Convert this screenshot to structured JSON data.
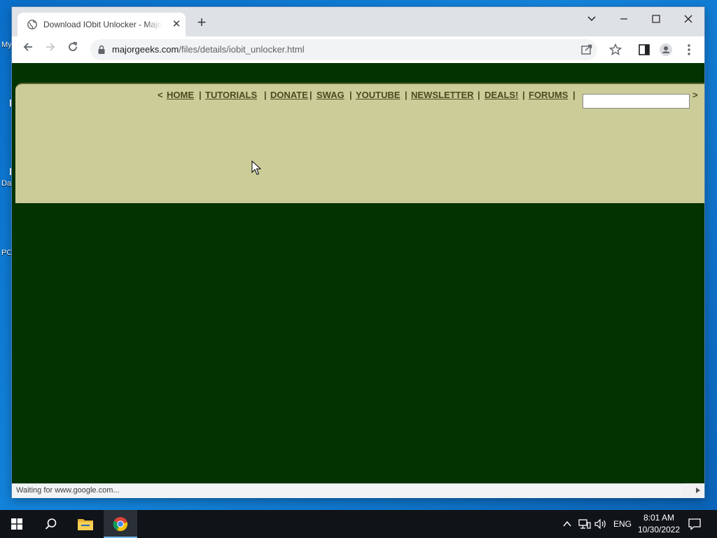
{
  "desktop": {
    "labels": [
      "My",
      "Da",
      "PC"
    ]
  },
  "browser": {
    "tab_title": "Download IObit Unlocker - MajorGeeks",
    "url_host": "majorgeeks.com",
    "url_path": "/files/details/iobit_unlocker.html",
    "status_text": "Waiting for www.google.com..."
  },
  "page": {
    "nav_open": "<",
    "nav_close": ">",
    "nav_items": [
      "HOME",
      "TUTORIALS",
      "DONATE",
      "SWAG",
      "YOUTUBE",
      "NEWSLETTER",
      "DEALS!",
      "FORUMS"
    ],
    "separator": "|",
    "search_value": ""
  },
  "taskbar": {
    "language": "ENG",
    "time": "8:01 AM",
    "date": "10/30/2022"
  },
  "colors": {
    "page_bg": "#033300",
    "banner_bg": "#cccc99",
    "nav_text": "#4a4a20"
  }
}
